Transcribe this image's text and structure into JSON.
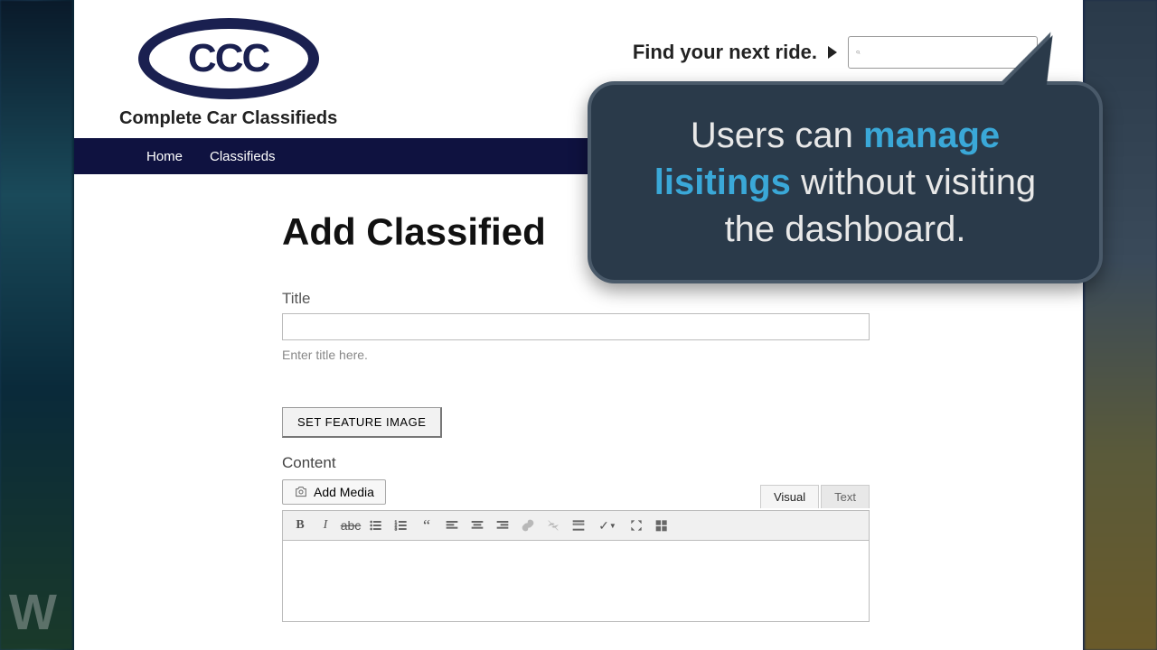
{
  "brand": {
    "logo_initials": "CCC",
    "name": "Complete Car Classifieds"
  },
  "search": {
    "label": "Find your next ride.",
    "placeholder": ""
  },
  "nav": {
    "items": [
      "Home",
      "Classifieds"
    ]
  },
  "page": {
    "heading": "Add Classified",
    "title_label": "Title",
    "title_hint": "Enter title here.",
    "title_value": "",
    "feature_button": "SET FEATURE IMAGE",
    "content_label": "Content",
    "add_media": "Add Media"
  },
  "editor": {
    "tabs": {
      "visual": "Visual",
      "text": "Text"
    }
  },
  "callout": {
    "line1": "Users can",
    "highlight": "manage lisitings",
    "line2": "without visiting the dashboard."
  },
  "watermark": "W"
}
